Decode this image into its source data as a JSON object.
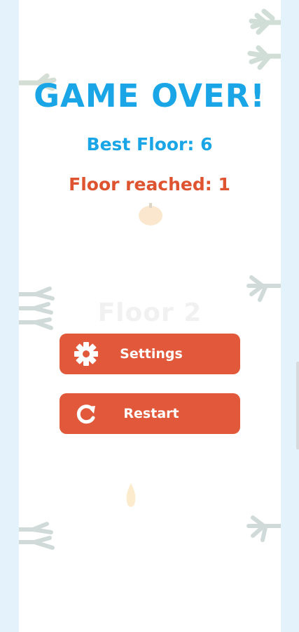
{
  "game_over": {
    "title": "GAME OVER!",
    "best_floor_text": "Best Floor: 6",
    "floor_reached_text": "Floor reached: 1"
  },
  "buttons": {
    "settings_label": "Settings",
    "restart_label": "Restart"
  },
  "background": {
    "floor_label": "Floor 2"
  },
  "colors": {
    "title": "#1aa6e6",
    "best_floor": "#1aa6e6",
    "floor_reached": "#df5430",
    "button": "#e1583a",
    "side_panel": "#e4f3fb"
  },
  "icons": {
    "settings": "gear-icon",
    "restart": "restart-icon"
  }
}
